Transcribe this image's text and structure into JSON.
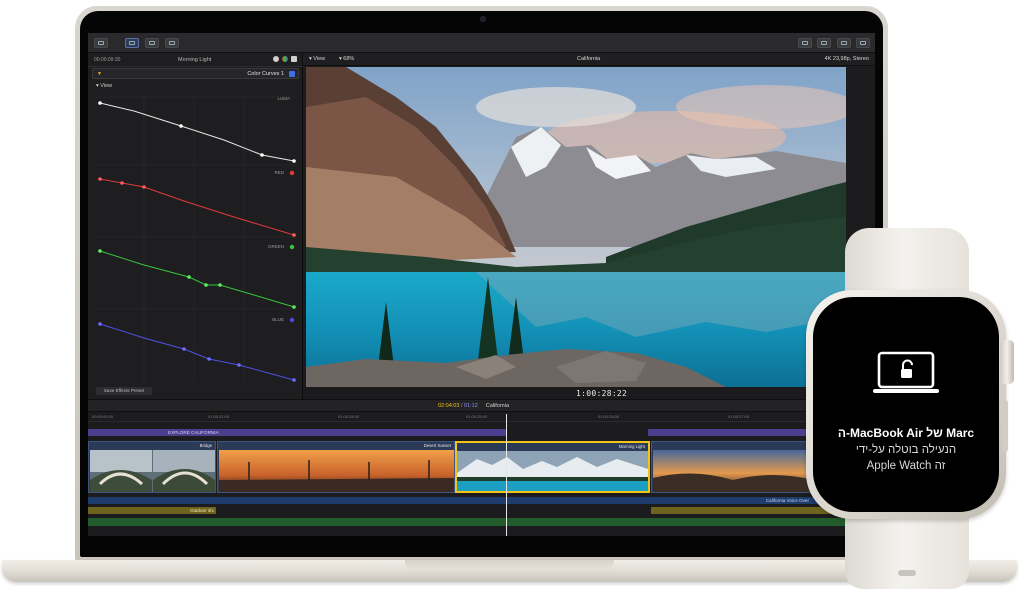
{
  "fcp": {
    "inspector": {
      "timecode": "00:00:09:30",
      "clip_name": "Morning Light",
      "effect_name": "Color Curves 1",
      "section": "View",
      "curve_labels": [
        "LUMA",
        "RED",
        "GREEN",
        "BLUE"
      ],
      "save_preset": "Save Effects Preset"
    },
    "viewer": {
      "view_menu": "View",
      "zoom": "68%",
      "project": "California",
      "format": "4K 23,98p, Stereo",
      "timecode": "1:00:28:22"
    },
    "timeline": {
      "position": "02:04:03",
      "duration": "01:12",
      "project": "California",
      "ruler": [
        "00:00:00:00",
        "01:00:21:00",
        "01:00:24:00",
        "01:00:25:00",
        "01:00:28:00",
        "01:00:27:00"
      ],
      "title_clip": "EXPLORE CALIFORNIA",
      "clips": [
        "Bridge",
        "Desert Sunset",
        "Morning Light",
        ""
      ],
      "audio_voiceover": "California Voice Over",
      "audio_sfx": "Outdoor sfx"
    },
    "colors": {
      "luma": "#e8e8e8",
      "red": "#e23a3a",
      "green": "#39c43f",
      "blue": "#4b4be0",
      "selection": "#f0c419"
    }
  },
  "watch": {
    "title": "ה-MacBook Air של Marc",
    "line1": "הנעילה בוטלה על-ידי",
    "line2": "Apple Watch זה",
    "icon": "laptop-unlocked-icon"
  }
}
